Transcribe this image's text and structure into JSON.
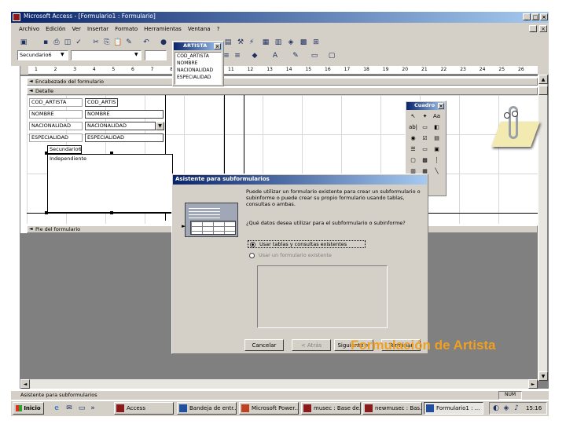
{
  "window": {
    "title": "Microsoft Access - [Formulario1 : Formulario]",
    "controls": [
      "_",
      "□",
      "×"
    ]
  },
  "menu": [
    "Archivo",
    "Edición",
    "Ver",
    "Insertar",
    "Formato",
    "Herramientas",
    "Ventana",
    "?"
  ],
  "formatting": {
    "object_value": "Secundario6",
    "font_value": "",
    "size_value": ""
  },
  "field_list": {
    "title": "ARTISTA",
    "fields": [
      "COD_ARTISTA",
      "NOMBRE",
      "NACIONALIDAD",
      "ESPECIALIDAD"
    ]
  },
  "ruler": {
    "numbers": [
      "1",
      "2",
      "3",
      "4",
      "5",
      "6",
      "7",
      "8",
      "9",
      "10",
      "11",
      "12",
      "13",
      "14",
      "15",
      "16",
      "17",
      "18",
      "19",
      "20",
      "21",
      "22",
      "23",
      "24",
      "25",
      "26"
    ]
  },
  "form": {
    "header_section": "Encabezado del formulario",
    "detail_section": "Detalle",
    "footer_section": "Pie del formulario",
    "rows": [
      {
        "label": "COD_ARTISTA",
        "field": "COD_ARTIS"
      },
      {
        "label": "NOMBRE",
        "field": "NOMBRE"
      },
      {
        "label": "NACIONALIDAD",
        "field": "NACIONALIDAD"
      },
      {
        "label": "ESPECIALIDAD",
        "field": "ESPECIALIDAD"
      }
    ],
    "subform_label": "Secundario6",
    "subform_placeholder": "Independiente"
  },
  "toolbox": {
    "title": "Cuadro",
    "close": "×",
    "icons": [
      "select-arrow-icon",
      "wand-icon",
      "label-icon",
      "textbox-icon",
      "option-group-icon",
      "toggle-icon",
      "option-icon",
      "checkbox-icon",
      "combo-icon",
      "listbox-icon",
      "button-icon",
      "image-icon",
      "unbound-frame-icon",
      "bound-frame-icon",
      "page-break-icon",
      "tab-icon",
      "subform-icon",
      "line-icon",
      "rect-icon",
      "more-controls-icon"
    ]
  },
  "wizard": {
    "title": "Asistente para subformularios",
    "intro": "Puede utilizar un formulario existente para crear un subformulario o subinforme o puede crear su propio formulario usando tablas, consultas o ambas.",
    "question": "¿Qué datos desea utilizar para el subformulario o subinforme?",
    "option1": "Usar tablas y consultas existentes",
    "option2": "Usar un formulario existente",
    "cancel": "Cancelar",
    "back": "< Atrás",
    "next": "Siguiente >",
    "finish": "Terminar"
  },
  "overlay_caption": "Formulación de Artista",
  "status": {
    "text": "Asistente para subformularios",
    "num": "NUM"
  },
  "taskbar": {
    "start": "Inicio",
    "tasks": [
      "Access",
      "Bandeja de entr...",
      "Microsoft Power...",
      "musec : Base de...",
      "newmusec : Bas...",
      "Formulario1 : ..."
    ],
    "clock": "15:16"
  },
  "colors": {
    "face": "#d4d0c8",
    "titlebar": "#0a246a",
    "workspace": "#808080",
    "caption": "#f0a020"
  }
}
